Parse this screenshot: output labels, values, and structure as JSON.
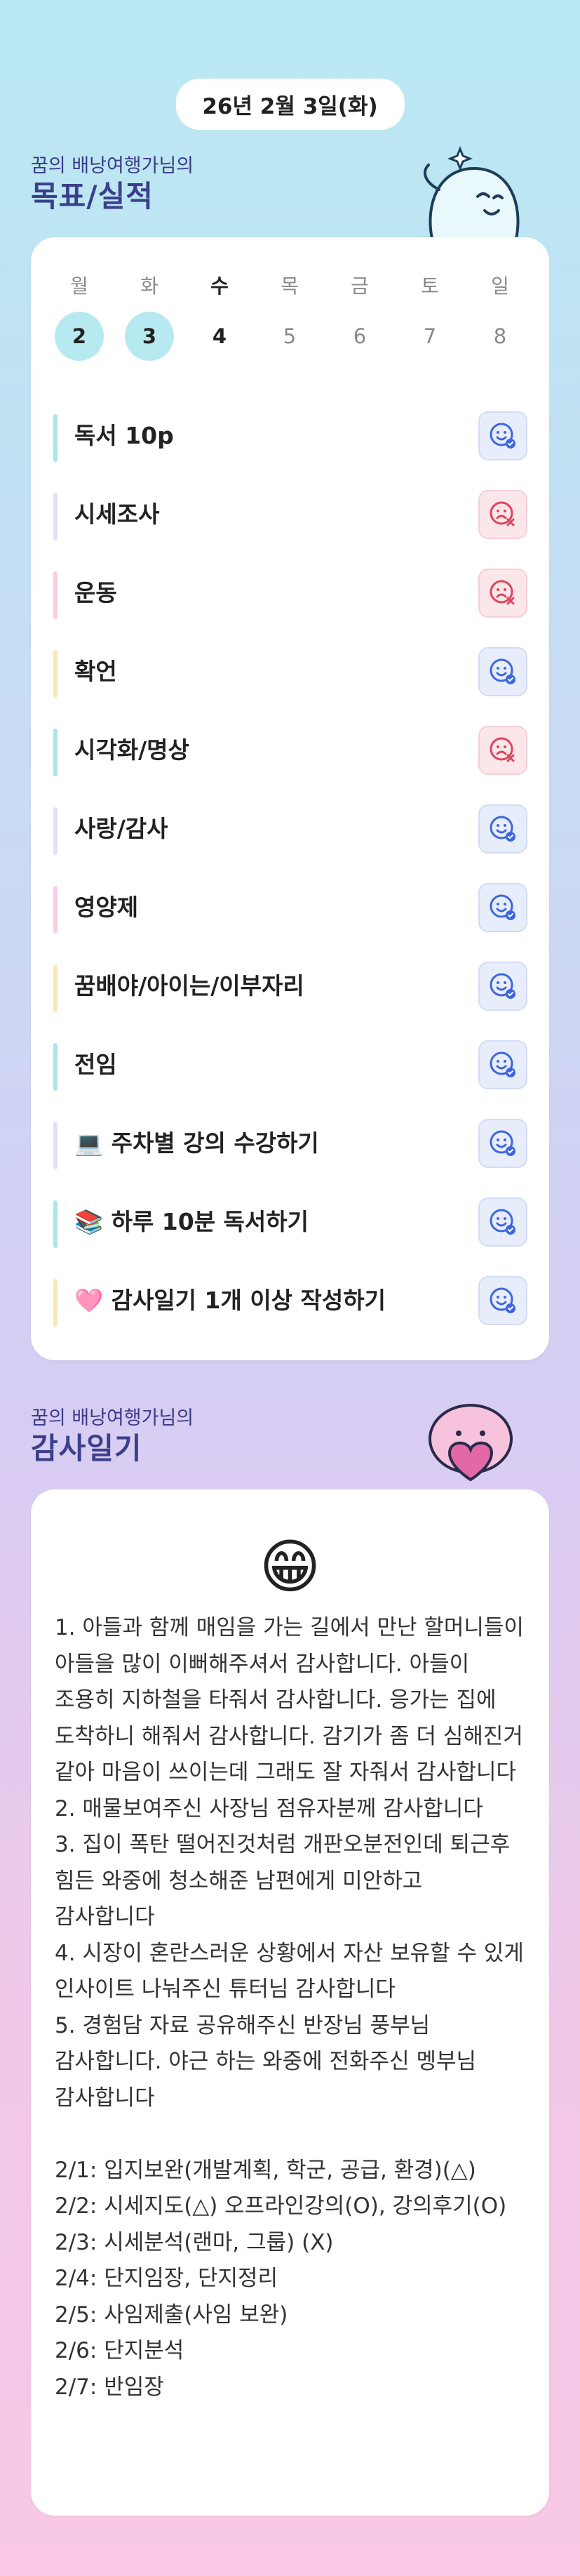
{
  "date_pill": "26년 2월 3일(화)",
  "goals_section": {
    "subtitle": "꿈의 배낭여행가님의",
    "title": "목표/실적"
  },
  "week": [
    {
      "day": "월",
      "num": "2",
      "state": "done"
    },
    {
      "day": "화",
      "num": "3",
      "state": "done"
    },
    {
      "day": "수",
      "num": "4",
      "state": "today"
    },
    {
      "day": "목",
      "num": "5",
      "state": "future"
    },
    {
      "day": "금",
      "num": "6",
      "state": "future"
    },
    {
      "day": "토",
      "num": "7",
      "state": "future"
    },
    {
      "day": "일",
      "num": "8",
      "state": "future"
    }
  ],
  "habits": [
    {
      "label": "독서 10p",
      "bar_color": "#a8e6ea",
      "status": "achieved",
      "status_icon": "smile-check-icon"
    },
    {
      "label": "시세조사",
      "bar_color": "#e6def7",
      "status": "missed",
      "status_icon": "sad-x-icon"
    },
    {
      "label": "운동",
      "bar_color": "#f7cfe4",
      "status": "missed",
      "status_icon": "sad-x-icon"
    },
    {
      "label": "확언",
      "bar_color": "#fbe6b8",
      "status": "achieved",
      "status_icon": "smile-check-icon"
    },
    {
      "label": "시각화/명상",
      "bar_color": "#a8e6ea",
      "status": "missed",
      "status_icon": "sad-x-icon"
    },
    {
      "label": "사랑/감사",
      "bar_color": "#e6def7",
      "status": "achieved",
      "status_icon": "smile-check-icon"
    },
    {
      "label": "영양제",
      "bar_color": "#f7cfe4",
      "status": "achieved",
      "status_icon": "smile-check-icon"
    },
    {
      "label": "꿈배야/아이는/이부자리",
      "bar_color": "#fbe6b8",
      "status": "achieved",
      "status_icon": "smile-check-icon"
    },
    {
      "label": "전임",
      "bar_color": "#a8e6ea",
      "status": "achieved",
      "status_icon": "smile-check-icon"
    },
    {
      "label": "💻 주차별 강의 수강하기",
      "bar_color": "#e6def7",
      "status": "achieved",
      "status_icon": "smile-check-icon"
    },
    {
      "label": "📚 하루 10분 독서하기",
      "bar_color": "#a8e6ea",
      "status": "achieved",
      "status_icon": "smile-check-icon"
    },
    {
      "label": "🩷 감사일기 1개 이상 작성하기",
      "bar_color": "#fbe6b8",
      "status": "achieved",
      "status_icon": "smile-check-icon"
    }
  ],
  "gratitude_section": {
    "subtitle": "꿈의 배낭여행가님의",
    "title": "감사일기"
  },
  "gratitude": {
    "emoji": "😁",
    "text": "1. 아들과 함께 매임을 가는 길에서 만난 할머니들이 아들을 많이 이뻐해주셔서 감사합니다. 아들이 조용히 지하철을 타줘서 감사합니다. 응가는 집에 도착하니 해줘서 감사합니다. 감기가 좀 더 심해진거 같아 마음이 쓰이는데 그래도 잘 자줘서 감사합니다\n2. 매물보여주신 사장님 점유자분께 감사합니다\n3. 집이 폭탄 떨어진것처럼 개판오분전인데 퇴근후 힘든 와중에 청소해준 남편에게 미안하고 감사합니다\n4. 시장이 혼란스러운 상황에서 자산 보유할 수 있게 인사이트 나눠주신 튜터님 감사합니다\n5. 경험담 자료 공유해주신 반장님 풍부님 감사합니다. 야근 하는 와중에 전화주신 멩부님 감사합니다\n\n2/1: 입지보완(개발계획, 학군, 공급, 환경)(△)\n2/2: 시세지도(△) 오프라인강의(O), 강의후기(O)\n2/3: 시세분석(랜마, 그룹) (X)\n2/4: 단지임장, 단지정리\n2/5: 사임제출(사임 보완)\n2/6: 단지분석\n2/7: 반임장"
  }
}
